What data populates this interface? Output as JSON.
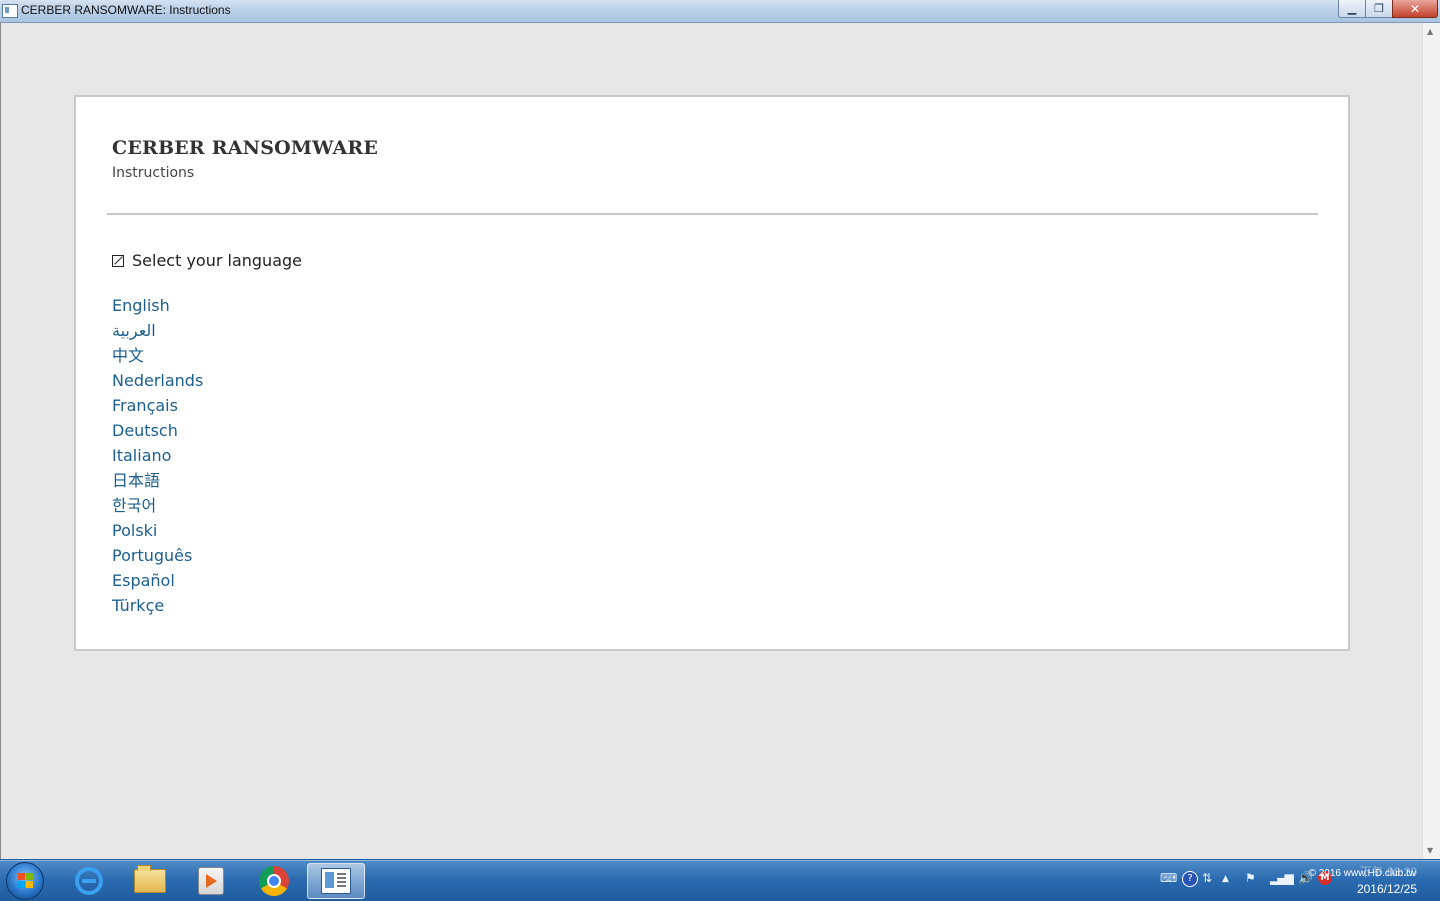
{
  "window": {
    "title": "CERBER RANSOMWARE: Instructions",
    "controls": {
      "minimize": "▁",
      "restore": "❐",
      "close": "✕"
    }
  },
  "page": {
    "title": "CERBER RANSOMWARE",
    "subtitle": "Instructions",
    "language_heading": "Select your language",
    "languages": [
      "English",
      "العربية",
      "中文",
      "Nederlands",
      "Français",
      "Deutsch",
      "Italiano",
      "日本語",
      "한국어",
      "Polski",
      "Português",
      "Español",
      "Türkçe"
    ]
  },
  "taskbar": {
    "apps": [
      {
        "name": "Internet Explorer",
        "icon": "ie-icon"
      },
      {
        "name": "Windows Explorer",
        "icon": "folder-icon"
      },
      {
        "name": "Media Player",
        "icon": "media-icon"
      },
      {
        "name": "Google Chrome",
        "icon": "chrome-icon"
      },
      {
        "name": "Instructions",
        "icon": "document-icon",
        "active": true
      }
    ],
    "tray": {
      "watermark": "© 2016 www.HD.club.tw",
      "time": "下午 08:20",
      "date": "2016/12/25"
    }
  },
  "colors": {
    "link": "#1b5f8f",
    "background": "#e7e7e7",
    "card": "#ffffff",
    "taskbar": "#2b6bb0"
  }
}
